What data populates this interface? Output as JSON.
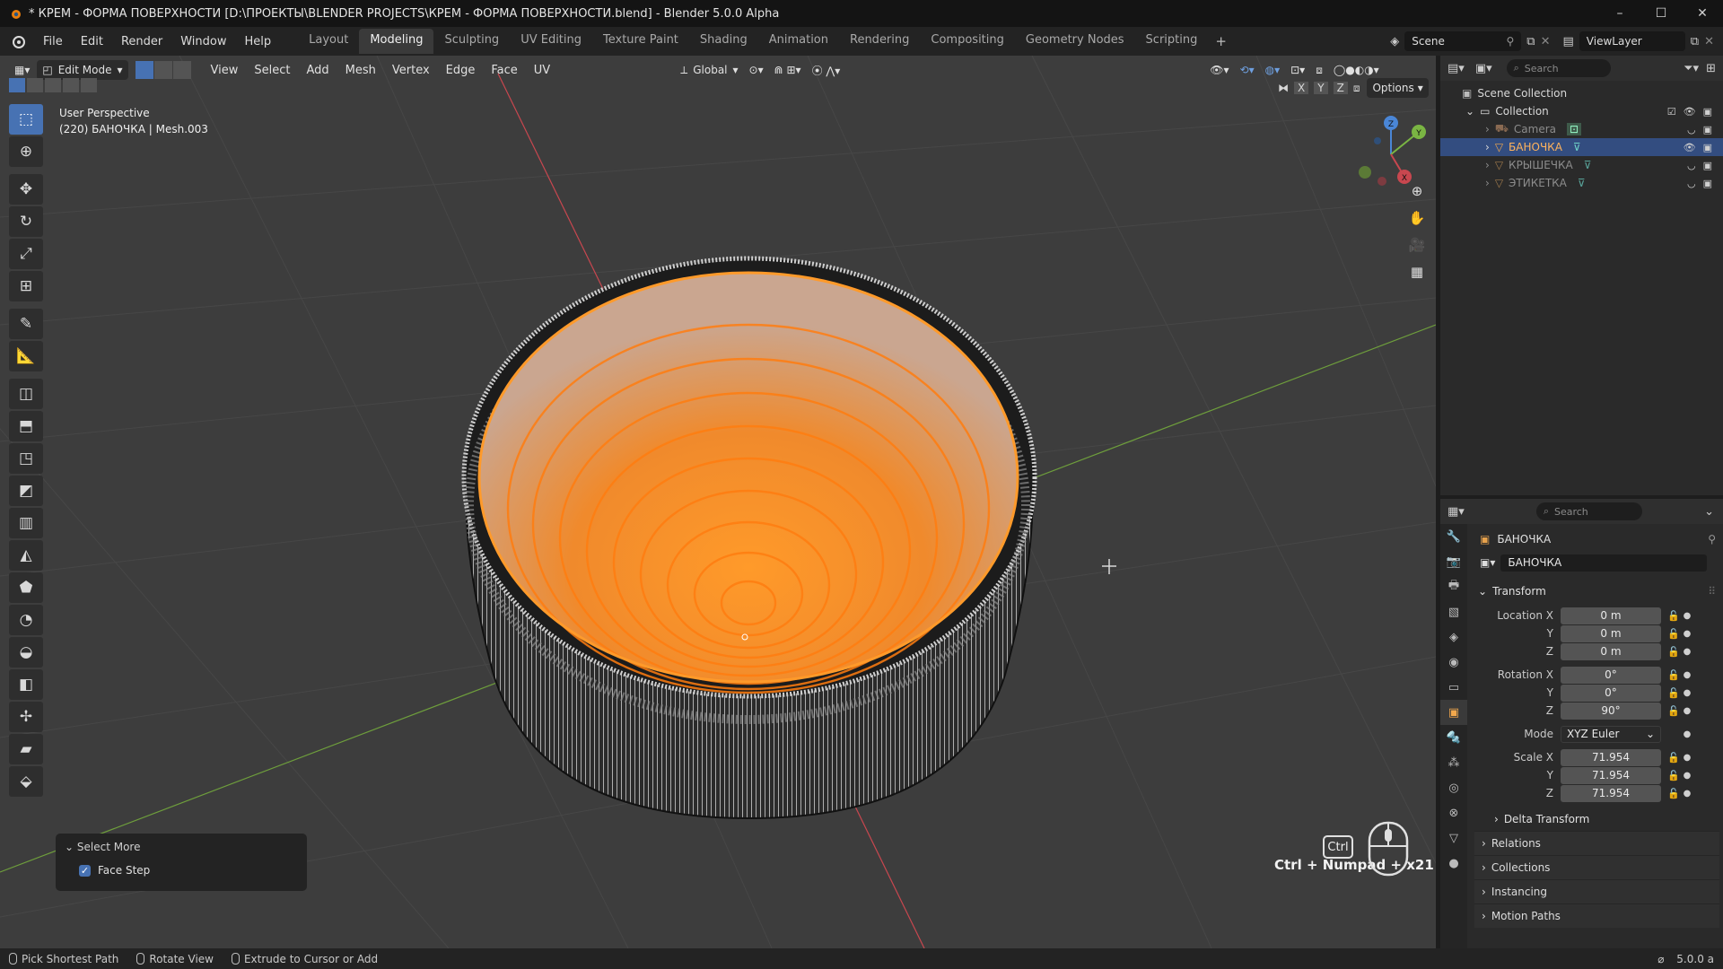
{
  "window": {
    "title": "* КРЕМ - ФОРМА ПОВЕРХНОСТИ [D:\\ПРОЕКТЫ\\BLENDER PROJECTS\\КРЕМ - ФОРМА ПОВЕРХНОСТИ.blend] - Blender 5.0.0 Alpha",
    "controls": [
      "–",
      "☐",
      "✕"
    ]
  },
  "menu": {
    "items": [
      "File",
      "Edit",
      "Render",
      "Window",
      "Help"
    ],
    "tabs": [
      {
        "label": "Layout",
        "active": false
      },
      {
        "label": "Modeling",
        "active": true
      },
      {
        "label": "Sculpting",
        "active": false
      },
      {
        "label": "UV Editing",
        "active": false
      },
      {
        "label": "Texture Paint",
        "active": false
      },
      {
        "label": "Shading",
        "active": false
      },
      {
        "label": "Animation",
        "active": false
      },
      {
        "label": "Rendering",
        "active": false
      },
      {
        "label": "Compositing",
        "active": false
      },
      {
        "label": "Geometry Nodes",
        "active": false
      },
      {
        "label": "Scripting",
        "active": false
      }
    ],
    "add_tab": "+",
    "scene": "Scene",
    "view_layer": "ViewLayer"
  },
  "viewport": {
    "mode": "Edit Mode",
    "menus": [
      "View",
      "Select",
      "Add",
      "Mesh",
      "Vertex",
      "Edge",
      "Face",
      "UV"
    ],
    "orientation": "Global",
    "axes": [
      "X",
      "Y",
      "Z"
    ],
    "options": "Options",
    "perspective": "User Perspective",
    "object_info": "(220) БАНОЧКА | Mesh.003",
    "keyhint": "Ctrl + Numpad + x21",
    "ctrl_key": "Ctrl",
    "gizmo_axes": {
      "x": "X",
      "y": "Y",
      "z": "Z"
    },
    "colors": {
      "selection": "#ff8a1c",
      "background": "#3d3d3d",
      "x_axis": "#c8474f",
      "y_axis": "#7ab543"
    }
  },
  "operator_panel": {
    "title": "Select More",
    "option": "Face Step",
    "checked": true
  },
  "outliner": {
    "search_placeholder": "Search",
    "root": "Scene Collection",
    "collection": "Collection",
    "items": [
      {
        "name": "Camera",
        "selected": false
      },
      {
        "name": "БАНОЧКА",
        "selected": true
      },
      {
        "name": "КРЫШЕЧКА",
        "selected": false
      },
      {
        "name": "ЭТИКЕТКА",
        "selected": false
      }
    ]
  },
  "properties": {
    "search_placeholder": "Search",
    "object_name": "БАНОЧКА",
    "datablock_name": "БАНОЧКА",
    "transform_title": "Transform",
    "location_label": "Location X",
    "rotation_label": "Rotation X",
    "scale_label": "Scale X",
    "y_label": "Y",
    "z_label": "Z",
    "location": {
      "x": "0 m",
      "y": "0 m",
      "z": "0 m"
    },
    "rotation": {
      "x": "0°",
      "y": "0°",
      "z": "90°"
    },
    "mode_label": "Mode",
    "mode_value": "XYZ Euler",
    "scale": {
      "x": "71.954",
      "y": "71.954",
      "z": "71.954"
    },
    "delta": "Delta Transform",
    "sections": [
      "Relations",
      "Collections",
      "Instancing",
      "Motion Paths"
    ]
  },
  "statusbar": {
    "left": "Pick Shortest Path",
    "middle": "Rotate View",
    "right": "Extrude to Cursor or Add",
    "version": "5.0.0 a"
  }
}
